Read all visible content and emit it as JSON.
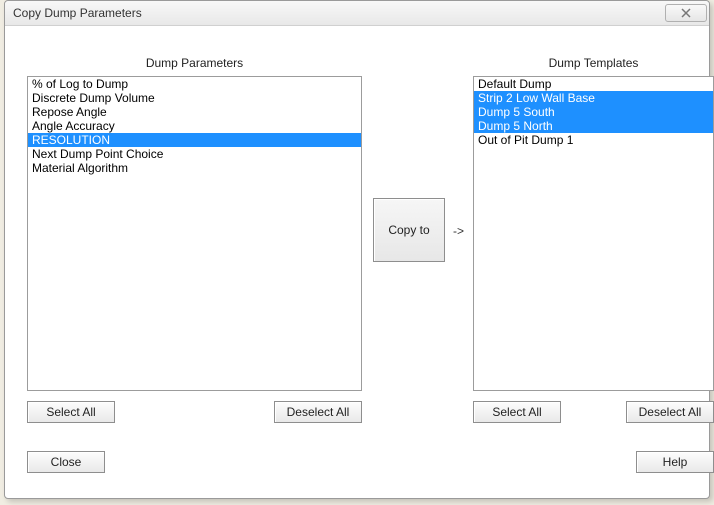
{
  "window": {
    "title": "Copy Dump Parameters"
  },
  "left": {
    "header": "Dump Parameters",
    "items": [
      {
        "label": "% of Log to Dump",
        "selected": false
      },
      {
        "label": "Discrete Dump Volume",
        "selected": false
      },
      {
        "label": "Repose Angle",
        "selected": false
      },
      {
        "label": "Angle Accuracy",
        "selected": false
      },
      {
        "label": "RESOLUTION",
        "selected": true
      },
      {
        "label": "Next Dump Point Choice",
        "selected": false
      },
      {
        "label": "Material Algorithm",
        "selected": false
      }
    ],
    "select_all": "Select All",
    "deselect_all": "Deselect All"
  },
  "right": {
    "header": "Dump Templates",
    "items": [
      {
        "label": "Default Dump",
        "selected": false
      },
      {
        "label": "Strip 2 Low Wall Base",
        "selected": true
      },
      {
        "label": "Dump 5 South",
        "selected": true
      },
      {
        "label": "Dump 5 North",
        "selected": true
      },
      {
        "label": "Out of Pit Dump 1",
        "selected": false
      }
    ],
    "select_all": "Select All",
    "deselect_all": "Deselect All"
  },
  "copy_button": "Copy to",
  "arrow": "->",
  "footer": {
    "close": "Close",
    "help": "Help"
  }
}
